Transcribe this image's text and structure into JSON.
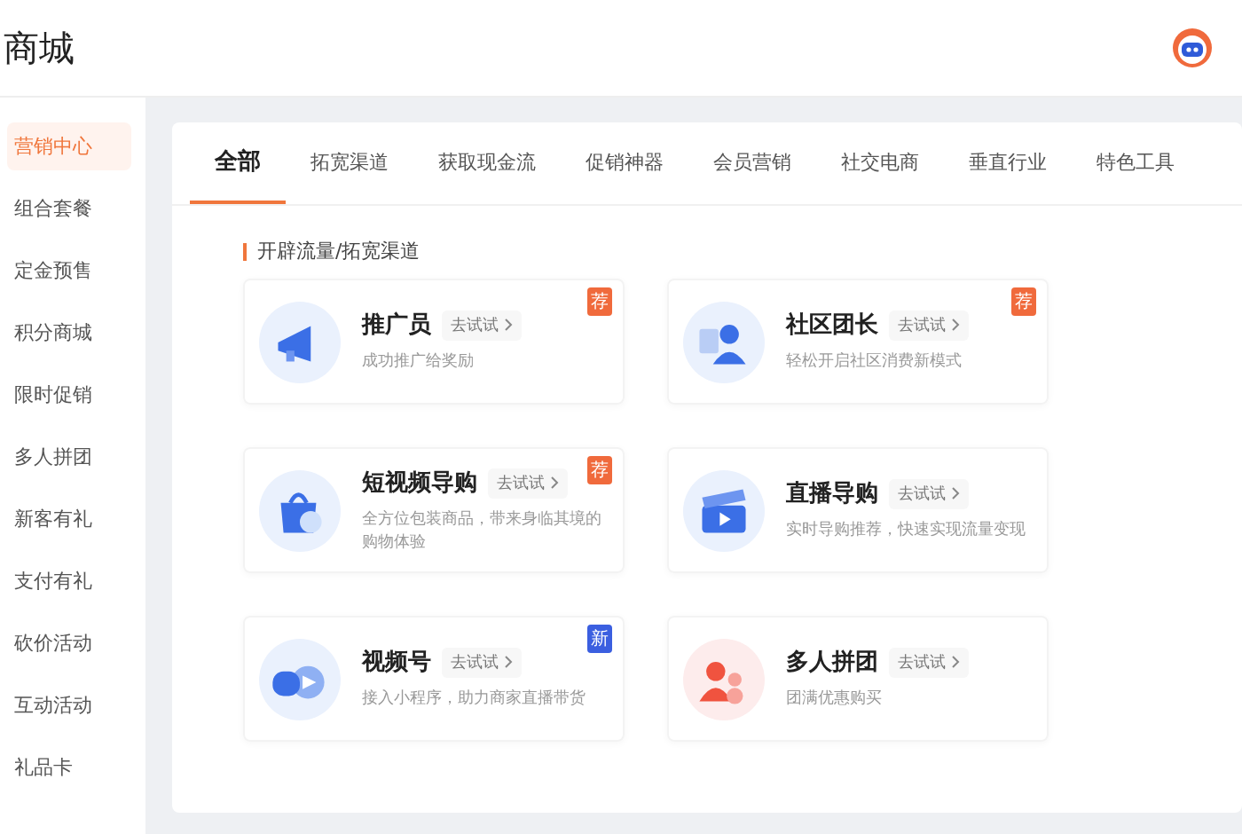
{
  "header": {
    "title": "商城"
  },
  "sidebar": {
    "items": [
      {
        "label": "营销中心",
        "selected": true
      },
      {
        "label": "组合套餐",
        "selected": false
      },
      {
        "label": "定金预售",
        "selected": false
      },
      {
        "label": "积分商城",
        "selected": false
      },
      {
        "label": "限时促销",
        "selected": false
      },
      {
        "label": "多人拼团",
        "selected": false
      },
      {
        "label": "新客有礼",
        "selected": false
      },
      {
        "label": "支付有礼",
        "selected": false
      },
      {
        "label": "砍价活动",
        "selected": false
      },
      {
        "label": "互动活动",
        "selected": false
      },
      {
        "label": "礼品卡",
        "selected": false
      }
    ]
  },
  "tabs": [
    {
      "label": "全部",
      "selected": true
    },
    {
      "label": "拓宽渠道",
      "selected": false
    },
    {
      "label": "获取现金流",
      "selected": false
    },
    {
      "label": "促销神器",
      "selected": false
    },
    {
      "label": "会员营销",
      "selected": false
    },
    {
      "label": "社交电商",
      "selected": false
    },
    {
      "label": "垂直行业",
      "selected": false
    },
    {
      "label": "特色工具",
      "selected": false
    }
  ],
  "section": {
    "title": "开辟流量/拓宽渠道"
  },
  "cards": [
    {
      "title": "推广员",
      "action": "去试试",
      "description": "成功推广给奖励",
      "badge": "荐"
    },
    {
      "title": "社区团长",
      "action": "去试试",
      "description": "轻松开启社区消费新模式",
      "badge": "荐"
    },
    {
      "title": "短视频导购",
      "action": "去试试",
      "description": "全方位包装商品，带来身临其境的购物体验",
      "badge": "荐"
    },
    {
      "title": "直播导购",
      "action": "去试试",
      "description": "实时导购推荐，快速实现流量变现"
    },
    {
      "title": "视频号",
      "action": "去试试",
      "description": "接入小程序，助力商家直播带货",
      "badge": "新"
    },
    {
      "title": "多人拼团",
      "action": "去试试",
      "description": "团满优惠购买"
    }
  ]
}
